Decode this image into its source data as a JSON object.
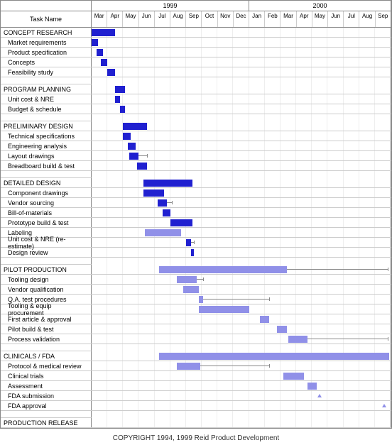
{
  "chart_data": {
    "type": "gantt",
    "title": "",
    "task_header": "Task Name",
    "years": [
      {
        "label": "1999",
        "months": [
          "Mar",
          "Apr",
          "May",
          "Jun",
          "Jul",
          "Aug",
          "Sep",
          "Oct",
          "Nov",
          "Dec"
        ]
      },
      {
        "label": "2000",
        "months": [
          "Jan",
          "Feb",
          "Mar",
          "Apr",
          "May",
          "Jun",
          "Jul",
          "Aug",
          "Sep"
        ]
      }
    ],
    "month_count": 19,
    "rows": [
      {
        "type": "phase",
        "name": "CONCEPT RESEARCH",
        "bars": [
          {
            "start": 0,
            "dur": 1.5,
            "style": "solid"
          }
        ]
      },
      {
        "type": "task",
        "name": "Market requirements",
        "bars": [
          {
            "start": 0,
            "dur": 0.4,
            "style": "solid"
          }
        ]
      },
      {
        "type": "task",
        "name": "Product specification",
        "bars": [
          {
            "start": 0.3,
            "dur": 0.4,
            "style": "solid"
          }
        ]
      },
      {
        "type": "task",
        "name": "Concepts",
        "bars": [
          {
            "start": 0.6,
            "dur": 0.4,
            "style": "solid"
          }
        ]
      },
      {
        "type": "task",
        "name": "Feasibility study",
        "bars": [
          {
            "start": 1.0,
            "dur": 0.5,
            "style": "solid"
          }
        ]
      },
      {
        "type": "spacer"
      },
      {
        "type": "phase",
        "name": "PROGRAM PLANNING",
        "bars": [
          {
            "start": 1.5,
            "dur": 0.6,
            "style": "solid"
          }
        ]
      },
      {
        "type": "task",
        "name": "Unit cost & NRE",
        "bars": [
          {
            "start": 1.5,
            "dur": 0.3,
            "style": "solid"
          }
        ]
      },
      {
        "type": "task",
        "name": "Budget & schedule",
        "bars": [
          {
            "start": 1.8,
            "dur": 0.3,
            "style": "solid"
          }
        ]
      },
      {
        "type": "spacer"
      },
      {
        "type": "phase",
        "name": "PRELIMINARY DESIGN",
        "bars": [
          {
            "start": 2.0,
            "dur": 1.5,
            "style": "solid"
          }
        ]
      },
      {
        "type": "task",
        "name": "Technical specifications",
        "bars": [
          {
            "start": 2.0,
            "dur": 0.5,
            "style": "solid"
          }
        ]
      },
      {
        "type": "task",
        "name": "Engineering analysis",
        "bars": [
          {
            "start": 2.3,
            "dur": 0.5,
            "style": "solid"
          }
        ]
      },
      {
        "type": "task",
        "name": "Layout drawings",
        "bars": [
          {
            "start": 2.4,
            "dur": 0.6,
            "style": "solid"
          }
        ],
        "whisker": {
          "start": 3.0,
          "dur": 0.5
        }
      },
      {
        "type": "task",
        "name": "Breadboard build & test",
        "bars": [
          {
            "start": 2.9,
            "dur": 0.6,
            "style": "solid"
          }
        ]
      },
      {
        "type": "spacer"
      },
      {
        "type": "phase",
        "name": "DETAILED DESIGN",
        "bars": [
          {
            "start": 3.3,
            "dur": 3.1,
            "style": "solid"
          }
        ]
      },
      {
        "type": "task",
        "name": "Component drawings",
        "bars": [
          {
            "start": 3.3,
            "dur": 1.3,
            "style": "solid"
          }
        ]
      },
      {
        "type": "task",
        "name": "Vendor sourcing",
        "bars": [
          {
            "start": 4.2,
            "dur": 0.6,
            "style": "solid"
          }
        ],
        "whisker": {
          "start": 4.8,
          "dur": 0.3
        }
      },
      {
        "type": "task",
        "name": "Bill-of-materials",
        "bars": [
          {
            "start": 4.5,
            "dur": 0.5,
            "style": "solid"
          }
        ]
      },
      {
        "type": "task",
        "name": "Prototype build & test",
        "bars": [
          {
            "start": 5.0,
            "dur": 1.4,
            "style": "solid"
          }
        ]
      },
      {
        "type": "task",
        "name": "Labeling",
        "bars": [
          {
            "start": 3.4,
            "dur": 2.3,
            "style": "light"
          }
        ]
      },
      {
        "type": "task",
        "name": "Unit cost & NRE (re-estimate)",
        "bars": [
          {
            "start": 6.0,
            "dur": 0.3,
            "style": "solid"
          }
        ],
        "whisker": {
          "start": 6.3,
          "dur": 0.2
        }
      },
      {
        "type": "task",
        "name": "Design review",
        "bars": [
          {
            "start": 6.3,
            "dur": 0.2,
            "style": "solid"
          }
        ]
      },
      {
        "type": "spacer"
      },
      {
        "type": "phase",
        "name": "PILOT PRODUCTION",
        "bars": [
          {
            "start": 4.3,
            "dur": 8.1,
            "style": "light"
          }
        ],
        "whisker": {
          "start": 12.4,
          "dur": 6.4
        }
      },
      {
        "type": "task",
        "name": "Tooling design",
        "bars": [
          {
            "start": 5.4,
            "dur": 1.3,
            "style": "light"
          }
        ],
        "whisker": {
          "start": 6.7,
          "dur": 0.4
        }
      },
      {
        "type": "task",
        "name": "Vendor qualification",
        "bars": [
          {
            "start": 5.8,
            "dur": 1.0,
            "style": "light"
          }
        ]
      },
      {
        "type": "task",
        "name": "Q.A. test procedures",
        "bars": [
          {
            "start": 6.8,
            "dur": 0.3,
            "style": "light"
          }
        ],
        "whisker": {
          "start": 7.1,
          "dur": 4.2
        }
      },
      {
        "type": "task",
        "name": "Tooling & equip procurement",
        "bars": [
          {
            "start": 6.8,
            "dur": 3.2,
            "style": "light"
          }
        ]
      },
      {
        "type": "task",
        "name": "First article & approval",
        "bars": [
          {
            "start": 10.7,
            "dur": 0.6,
            "style": "light"
          }
        ]
      },
      {
        "type": "task",
        "name": "Pilot build & test",
        "bars": [
          {
            "start": 11.8,
            "dur": 0.6,
            "style": "light"
          }
        ]
      },
      {
        "type": "task",
        "name": "Process validation",
        "bars": [
          {
            "start": 12.5,
            "dur": 1.2,
            "style": "light"
          }
        ],
        "whisker": {
          "start": 13.7,
          "dur": 5.1
        }
      },
      {
        "type": "spacer"
      },
      {
        "type": "phase",
        "name": "CLINICALS / FDA",
        "bars": [
          {
            "start": 4.3,
            "dur": 14.6,
            "style": "light"
          }
        ]
      },
      {
        "type": "task",
        "name": "Protocol & medical review",
        "bars": [
          {
            "start": 5.4,
            "dur": 1.5,
            "style": "light"
          }
        ],
        "whisker": {
          "start": 6.9,
          "dur": 4.4
        }
      },
      {
        "type": "task",
        "name": "Clinical trials",
        "bars": [
          {
            "start": 12.2,
            "dur": 1.3,
            "style": "light"
          }
        ]
      },
      {
        "type": "task",
        "name": "Assessment",
        "bars": [
          {
            "start": 13.7,
            "dur": 0.6,
            "style": "light"
          }
        ]
      },
      {
        "type": "task",
        "name": "FDA submission",
        "tri": 14.5
      },
      {
        "type": "task",
        "name": "FDA approval",
        "tri": 18.6
      },
      {
        "type": "spacer"
      },
      {
        "type": "phase",
        "name": "PRODUCTION RELEASE",
        "bars": []
      }
    ]
  },
  "footer": "COPYRIGHT 1994, 1999  Reid Product Development"
}
